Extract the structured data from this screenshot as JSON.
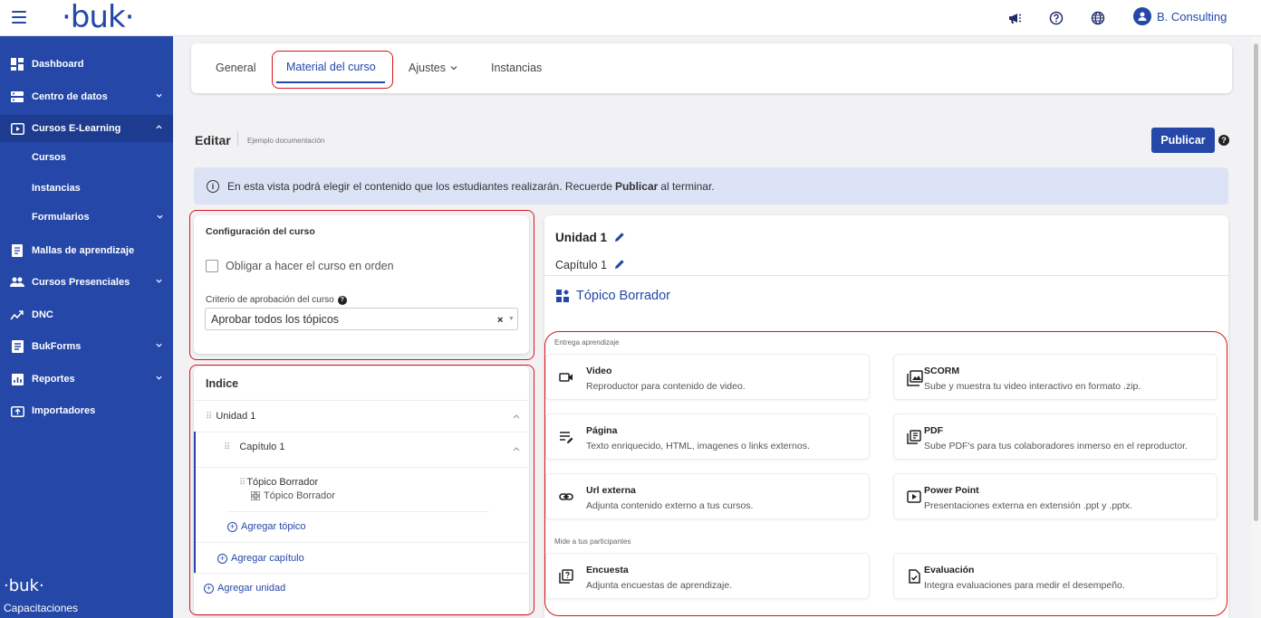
{
  "header": {
    "logo": "·buk·",
    "user_name": "B. Consulting"
  },
  "sidebar": {
    "items": [
      {
        "label": "Dashboard",
        "icon": "dashboard-icon"
      },
      {
        "label": "Centro de datos",
        "icon": "database-icon"
      },
      {
        "label": "Cursos E-Learning",
        "icon": "play-icon"
      },
      {
        "label": "Mallas de aprendizaje",
        "icon": "book-icon"
      },
      {
        "label": "Cursos Presenciales",
        "icon": "people-icon"
      },
      {
        "label": "DNC",
        "icon": "trend-icon"
      },
      {
        "label": "BukForms",
        "icon": "forms-icon"
      },
      {
        "label": "Reportes",
        "icon": "report-icon"
      },
      {
        "label": "Importadores",
        "icon": "import-icon"
      }
    ],
    "subitems": [
      "Cursos",
      "Instancias",
      "Formularios"
    ],
    "footer_logo": "·buk·",
    "footer_label": "Capacitaciones"
  },
  "tabs": {
    "general": "General",
    "material": "Material del curso",
    "ajustes": "Ajustes",
    "instancias": "Instancias"
  },
  "edit": {
    "title": "Editar",
    "subtitle": "Ejemplo documentación",
    "publish": "Publicar"
  },
  "banner": {
    "text_before": "En esta vista podrá elegir el contenido que los estudiantes realizarán. Recuerde",
    "text_bold": "Publicar",
    "text_after": "al terminar."
  },
  "config": {
    "title": "Configuración del curso",
    "checkbox_label": "Obligar a hacer el curso en orden",
    "criterio_label": "Criterio de aprobación del curso",
    "criterio_value": "Aprobar todos los tópicos"
  },
  "index": {
    "title": "Indice",
    "unidad": "Unidad 1",
    "capitulo": "Capítulo 1",
    "topico": "Tópico Borrador",
    "topico_sub": "Tópico Borrador",
    "add_topico": "Agregar tópico",
    "add_capitulo": "Agregar capítulo",
    "add_unidad": "Agregar unidad"
  },
  "editor": {
    "unidad": "Unidad 1",
    "capitulo": "Capítulo 1",
    "topic_title": "Tópico Borrador",
    "section1": "Entrega aprendizaje",
    "section2": "Mide a tus participantes",
    "options": [
      {
        "title": "Video",
        "desc": "Reproductor para contenido de video.",
        "icon": "video-icon"
      },
      {
        "title": "SCORM",
        "desc": "Sube y muestra tu video interactivo en formato .zip.",
        "icon": "scorm-icon"
      },
      {
        "title": "Página",
        "desc": "Texto enriquecido, HTML, imagenes o links externos.",
        "icon": "page-icon"
      },
      {
        "title": "PDF",
        "desc": "Sube PDF's para tus colaboradores inmerso en el reproductor.",
        "icon": "pdf-icon"
      },
      {
        "title": "Url externa",
        "desc": "Adjunta contenido externo a tus cursos.",
        "icon": "link-icon"
      },
      {
        "title": "Power Point",
        "desc": "Presentaciones externa en extensión .ppt y .pptx.",
        "icon": "powerpoint-icon"
      },
      {
        "title": "Encuesta",
        "desc": "Adjunta encuestas de aprendizaje.",
        "icon": "survey-icon"
      },
      {
        "title": "Evaluación",
        "desc": "Integra evaluaciones para medir el desempeño.",
        "icon": "evaluation-icon"
      }
    ]
  },
  "colors": {
    "brand": "#2447a8",
    "highlight": "#d9141b",
    "banner": "#dde3f6"
  }
}
